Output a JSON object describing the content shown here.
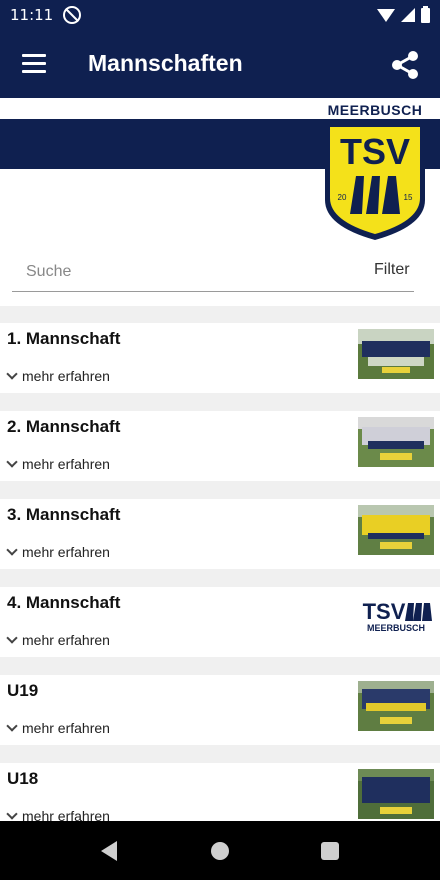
{
  "status_bar": {
    "time": "11:11"
  },
  "app_bar": {
    "title": "Mannschaften"
  },
  "banner": {
    "crest_top_text": "MEERBUSCH",
    "crest_letters": "TSV",
    "crest_year_left": "20",
    "crest_year_right": "15"
  },
  "search": {
    "placeholder": "Suche",
    "filter_label": "Filter"
  },
  "teams": [
    {
      "name": "1. Mannschaft",
      "more": "mehr erfahren",
      "thumb": "team-photo"
    },
    {
      "name": "2. Mannschaft",
      "more": "mehr erfahren",
      "thumb": "team-photo"
    },
    {
      "name": "3. Mannschaft",
      "more": "mehr erfahren",
      "thumb": "team-photo"
    },
    {
      "name": "4. Mannschaft",
      "more": "mehr erfahren",
      "thumb": "club-logo",
      "logo_letters": "TSV",
      "logo_text": "MEERBUSCH"
    },
    {
      "name": "U19",
      "more": "mehr erfahren",
      "thumb": "team-photo"
    },
    {
      "name": "U18",
      "more": "mehr erfahren",
      "thumb": "team-photo"
    }
  ],
  "colors": {
    "primary": "#0f2050",
    "accent": "#f4e11a"
  }
}
